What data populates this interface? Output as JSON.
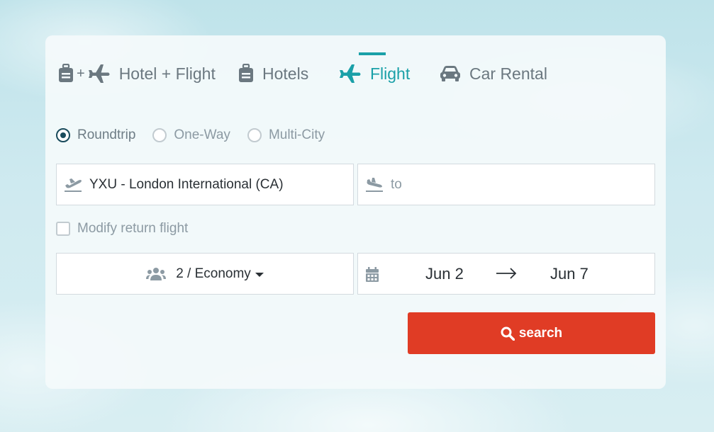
{
  "tabs": [
    {
      "label": "Hotel + Flight",
      "icon": "luggage-plus-plane-icon",
      "active": false
    },
    {
      "label": "Hotels",
      "icon": "luggage-icon",
      "active": false
    },
    {
      "label": "Flight",
      "icon": "plane-icon",
      "active": true
    },
    {
      "label": "Car Rental",
      "icon": "car-icon",
      "active": false
    }
  ],
  "tab_plus": "+",
  "trip_types": [
    {
      "label": "Roundtrip",
      "checked": true
    },
    {
      "label": "One-Way",
      "checked": false
    },
    {
      "label": "Multi-City",
      "checked": false
    }
  ],
  "from_field": {
    "value": "YXU - London International (CA)",
    "icon": "plane-departure-icon"
  },
  "to_field": {
    "placeholder": "to",
    "icon": "plane-arrival-icon"
  },
  "modify_return": {
    "label": "Modify return flight",
    "checked": false
  },
  "passengers": {
    "label": "2 / Economy",
    "icon": "users-icon"
  },
  "dates": {
    "depart": "Jun 2",
    "return": "Jun 7",
    "icon": "calendar-icon"
  },
  "search_button": {
    "label": "search",
    "icon": "search-icon"
  },
  "colors": {
    "accent": "#1aa0a8",
    "search": "#e03c25",
    "radio_checked": "#1a4b5c",
    "muted_text": "#8c9aa3"
  }
}
